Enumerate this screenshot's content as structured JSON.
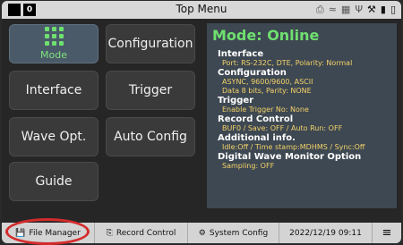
{
  "header": {
    "title": "Top Menu",
    "badge": "0"
  },
  "menu": {
    "mode": "Mode",
    "configuration": "Configuration",
    "interface": "Interface",
    "trigger": "Trigger",
    "wave": "Wave Opt.",
    "auto": "Auto Config",
    "guide": "Guide"
  },
  "status": {
    "mode": "Mode: Online",
    "items": [
      {
        "title": "Interface",
        "values": [
          "Port: RS-232C, DTE, Polarity: Normal"
        ]
      },
      {
        "title": "Configuration",
        "values": [
          "ASYNC, 9600/9600, ASCII",
          "Data 8 bits, Parity: NONE"
        ]
      },
      {
        "title": "Trigger",
        "values": [
          "Enable Trigger No: None"
        ]
      },
      {
        "title": "Record Control",
        "values": [
          "BUF0 / Save: OFF / Auto Run: OFF"
        ]
      },
      {
        "title": "Additional info.",
        "values": [
          "Idle:Off / Time stamp:MDHMS / Sync:Off"
        ]
      },
      {
        "title": "Digital Wave Monitor Option",
        "values": [
          "Sampling: OFF"
        ]
      }
    ]
  },
  "footer": {
    "file_manager": "File Manager",
    "record_control": "Record Control",
    "system_config": "System Config",
    "datetime": "2022/12/19  09:11"
  },
  "colors": {
    "highlight_ring": "#d42b2b",
    "mode_green": "#6fe06f",
    "value_yellow": "#f3d26a"
  }
}
